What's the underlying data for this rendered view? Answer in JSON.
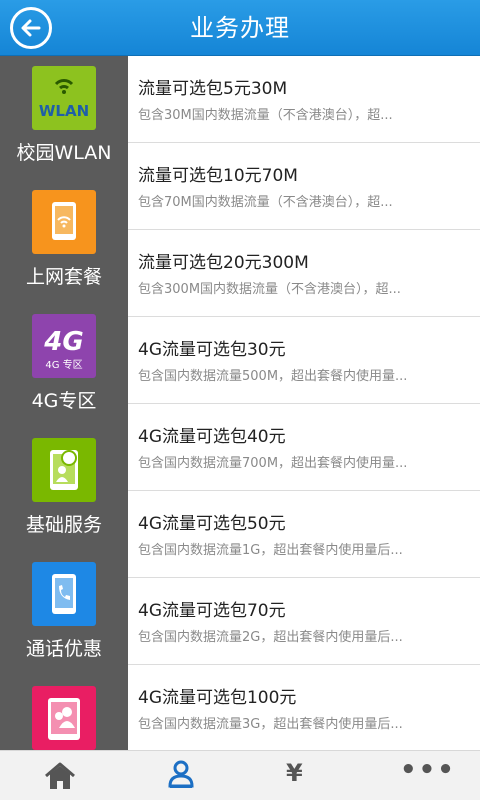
{
  "header": {
    "title": "业务办理"
  },
  "sidebar": {
    "items": [
      {
        "label": "校园WLAN",
        "icon": "wlan-icon",
        "color": "#8dc21f"
      },
      {
        "label": "上网套餐",
        "icon": "tablet-wifi-icon",
        "color": "#f7941d"
      },
      {
        "label": "4G专区",
        "icon": "4g-icon",
        "color": "#8e44ad"
      },
      {
        "label": "基础服务",
        "icon": "service-icon",
        "color": "#7ab800"
      },
      {
        "label": "通话优惠",
        "icon": "phone-icon",
        "color": "#1e88e5"
      },
      {
        "label": "",
        "icon": "user-card-icon",
        "color": "#e91e63"
      }
    ],
    "wlan_text": "WLAN",
    "fourg_text": "4G",
    "fourg_sub": "4G 专区"
  },
  "list": [
    {
      "title": "流量可选包5元30M",
      "desc": "包含30M国内数据流量（不含港澳台），超..."
    },
    {
      "title": "流量可选包10元70M",
      "desc": "包含70M国内数据流量（不含港澳台），超..."
    },
    {
      "title": "流量可选包20元300M",
      "desc": "包含300M国内数据流量（不含港澳台），超..."
    },
    {
      "title": "4G流量可选包30元",
      "desc": "包含国内数据流量500M，超出套餐内使用量..."
    },
    {
      "title": "4G流量可选包40元",
      "desc": "包含国内数据流量700M，超出套餐内使用量..."
    },
    {
      "title": "4G流量可选包50元",
      "desc": "包含国内数据流量1G，超出套餐内使用量后..."
    },
    {
      "title": "4G流量可选包70元",
      "desc": "包含国内数据流量2G，超出套餐内使用量后..."
    },
    {
      "title": "4G流量可选包100元",
      "desc": "包含国内数据流量3G，超出套餐内使用量后..."
    }
  ],
  "tabbar": {
    "tabs": [
      {
        "icon": "home-icon"
      },
      {
        "icon": "user-icon"
      },
      {
        "icon": "yen-icon",
        "glyph": "¥"
      },
      {
        "icon": "more-icon",
        "glyph": "•••"
      }
    ]
  },
  "colors": {
    "header": "#1c8fde",
    "sidebar": "#5b5b5b",
    "accent_tab": "#1c6fc4"
  }
}
